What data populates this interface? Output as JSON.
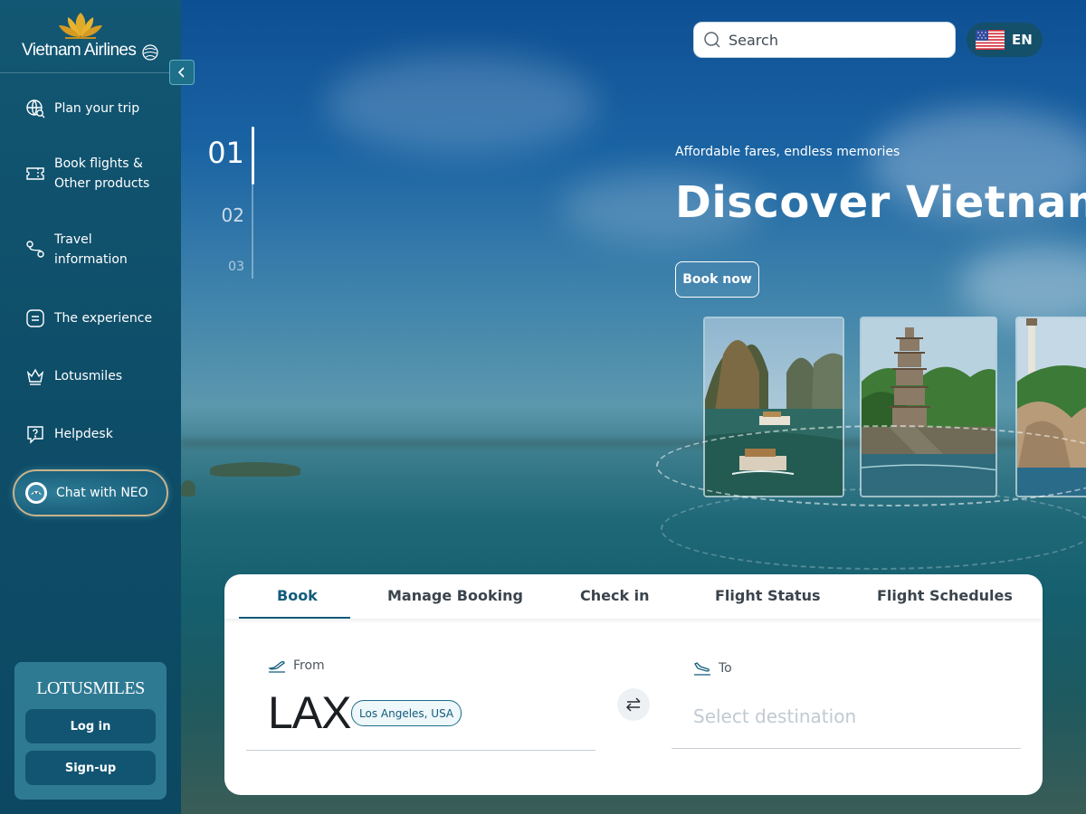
{
  "brand": {
    "name": "Vietnam Airlines",
    "colors": {
      "primary": "#125c7a",
      "gold": "#d9a42a",
      "sidebar": "#0e4d68"
    }
  },
  "sidebar": {
    "items": [
      {
        "label_lines": [
          "Plan your trip"
        ],
        "icon": "globe-search-icon"
      },
      {
        "label_lines": [
          "Book flights &",
          "Other products"
        ],
        "icon": "ticket-icon"
      },
      {
        "label_lines": [
          "Travel",
          "information"
        ],
        "icon": "route-pin-icon"
      },
      {
        "label_lines": [
          "The experience"
        ],
        "icon": "menu-box-icon"
      },
      {
        "label_lines": [
          "Lotusmiles"
        ],
        "icon": "crown-icon"
      },
      {
        "label_lines": [
          "Helpdesk"
        ],
        "icon": "help-chat-icon"
      }
    ],
    "chat": {
      "label": "Chat with NEO",
      "icon": "neo-avatar-icon"
    },
    "lotusmiles": {
      "brand": "LOTUSMILES",
      "login_label": "Log in",
      "signup_label": "Sign-up"
    }
  },
  "header": {
    "search": {
      "placeholder": "Search",
      "icon": "search-icon"
    },
    "language": {
      "code": "EN",
      "flag": "us-flag-icon"
    }
  },
  "hero": {
    "slides": [
      "01",
      "02",
      "03"
    ],
    "active_slide": "01",
    "tagline": "Affordable fares, endless memories",
    "headline": "Discover Vietnam",
    "cta": "Book now"
  },
  "booking": {
    "tabs": [
      "Book",
      "Manage Booking",
      "Check in",
      "Flight Status",
      "Flight Schedules"
    ],
    "active_tab": "Book",
    "from": {
      "label": "From",
      "code": "LAX",
      "city": "Los Angeles, USA",
      "icon": "plane-takeoff-icon"
    },
    "to": {
      "label": "To",
      "placeholder": "Select destination",
      "value": "",
      "icon": "plane-landing-icon"
    },
    "swap_icon": "swap-arrows-icon"
  }
}
